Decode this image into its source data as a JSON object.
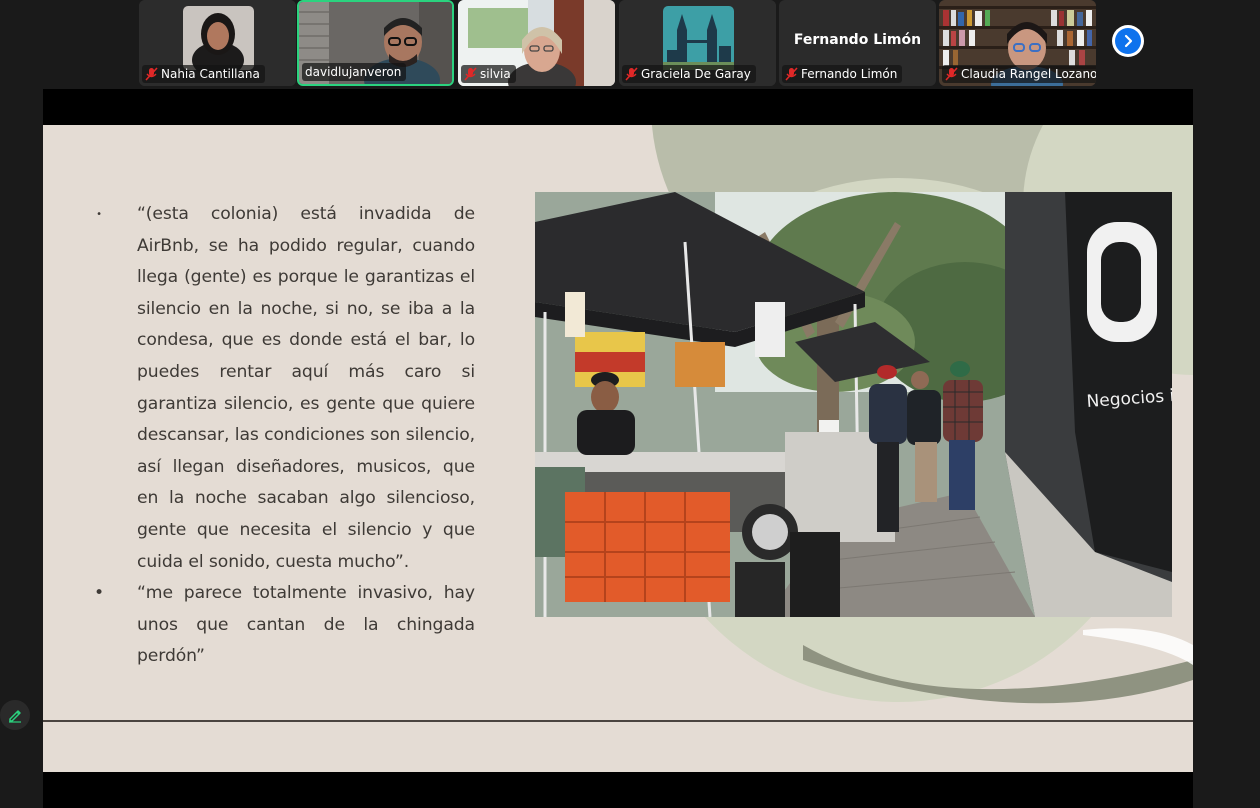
{
  "participants": [
    {
      "name": "Nahia Cantillana",
      "muted": true
    },
    {
      "name": "davidlujanveron",
      "muted": false,
      "active": true
    },
    {
      "name": "silvia",
      "muted": true
    },
    {
      "name": "Graciela De Garay",
      "muted": true
    },
    {
      "name": "Fernando Limón",
      "muted": true,
      "video_off": true,
      "display_name": "Fernando Limón"
    },
    {
      "name": "Claudia Rangel Lozano",
      "muted": true
    }
  ],
  "controls": {
    "next_page_icon": "chevron-right-icon",
    "annotate_icon": "pencil-icon"
  },
  "slide": {
    "bullets": [
      {
        "marker": "•",
        "text": "“(esta colonia) está invadida de AirBnb, se ha podido regular, cuando llega (gente) es porque le garantizas el silencio en la noche, si no, se iba a la condesa, que es donde está el bar, lo puedes rentar aquí más caro si garantiza silencio, es gente que quiere descansar, las condiciones son silencio, así llegan diseñadores, musicos, que en la noche sacaban algo silencioso, gente que necesita el silencio y que cuida el sonido, cuesta mucho”."
      },
      {
        "marker": "•",
        "text": "“me parece totalmente invasivo, hay unos que cantan de la chingada perdón”"
      }
    ],
    "photo_sign_text": "Negocios inmob"
  },
  "colors": {
    "slide_bg": "#e4dcd4",
    "shape_sage": "#d2d6c2",
    "shape_olive": "#b7bba5",
    "shape_dark": "#8c907d",
    "active_speaker": "#2bd37f",
    "muted_red": "#e02828",
    "zoom_blue": "#0e72ed"
  }
}
